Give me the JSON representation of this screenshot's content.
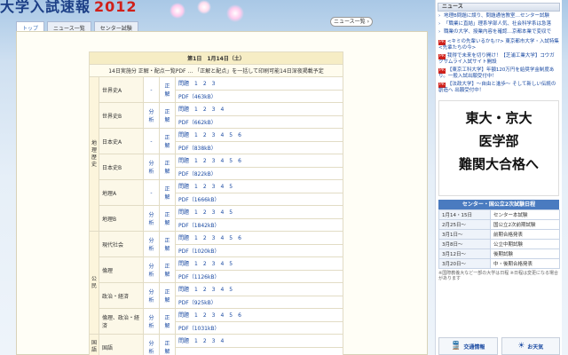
{
  "header": {
    "logo": "大学入試速報",
    "year": "2012",
    "news_list_button": "ニュース一覧 ›"
  },
  "tabs": [
    {
      "label": "トップ"
    },
    {
      "label": "ニュース一覧"
    },
    {
      "label": "センター試験"
    }
  ],
  "exam": {
    "day_header": "第1日　1月14日（土）",
    "note": "14日実施分 正解・配点一覧PDF … 「正解と配点」を一括して印刷可能14日深夜掲載予定",
    "categories": {
      "geo": "地理歴史",
      "civics": "公民",
      "lang": "国語"
    },
    "rows": [
      {
        "subject": "世界史A",
        "analysis": "-",
        "answer": "正解",
        "q": "問題　1　2　3",
        "pdf": "PDF（463kB）"
      },
      {
        "subject": "世界史B",
        "analysis": "分析",
        "answer": "正解",
        "q": "問題　1　2　3　4",
        "pdf": "PDF（662kB）"
      },
      {
        "subject": "日本史A",
        "analysis": "-",
        "answer": "正解",
        "q": "問題　1　2　3　4　5　6",
        "pdf": "PDF（838kB）"
      },
      {
        "subject": "日本史B",
        "analysis": "分析",
        "answer": "正解",
        "q": "問題　1　2　3　4　5　6",
        "pdf": "PDF（822kB）"
      },
      {
        "subject": "地理A",
        "analysis": "-",
        "answer": "正解",
        "q": "問題　1　2　3　4　5",
        "pdf": "PDF（1666kB）"
      },
      {
        "subject": "地理B",
        "analysis": "分析",
        "answer": "正解",
        "q": "問題　1　2　3　4　5",
        "pdf": "PDF（1842kB）"
      },
      {
        "subject": "現代社会",
        "analysis": "分析",
        "answer": "正解",
        "q": "問題　1　2　3　4　5　6",
        "pdf": "PDF（1020kB）"
      },
      {
        "subject": "倫理",
        "analysis": "分析",
        "answer": "正解",
        "q": "問題　1　2　3　4　5",
        "pdf": "PDF（1126kB）"
      },
      {
        "subject": "政治・経済",
        "analysis": "分析",
        "answer": "正解",
        "q": "問題　1　2　3　4　5",
        "pdf": "PDF（925kB）"
      },
      {
        "subject": "倫理、政治・経済",
        "analysis": "分析",
        "answer": "正解",
        "q": "問題　1　2　3　4　5　6",
        "pdf": "PDF（1031kB）"
      },
      {
        "subject": "国語",
        "analysis": "分析",
        "answer": "正解",
        "q": "問題　1　2　3　4",
        "pdf": ""
      }
    ]
  },
  "sidebar": {
    "news_header": "ニュース",
    "news": [
      "地理B問題に誤り、問題通信教室…センター試験",
      "「職業に直結」理系学部人気、社会科学系は急落",
      "職業の大学、授業内容を確認…京都本業で変収で"
    ],
    "ads": [
      {
        "tag": "PR",
        "text": "<キミの先輩いるかも!?> 東京都市大学・入試特集 <先輩たちの今>"
      },
      {
        "tag": "PR",
        "text": "我得で未来を切り開け！【芝浦工業大学】コウガクサムライ入試サイト開設"
      },
      {
        "tag": "PR",
        "text": "【東京工科大学】年額120万円を給奨学金制度あり。一般入試出願受付中！"
      },
      {
        "tag": "PR",
        "text": "【法政大学】〜自由と進歩〜 そして新しい伝統の創造へ 出願受付中！"
      }
    ],
    "banner": {
      "line1": "東大・京大",
      "line2": "医学部",
      "line3": "難関大合格へ"
    },
    "schedule_header": "センター・国公立2次試験日程",
    "schedule": [
      {
        "date": "1月14・15日",
        "event": "センター本試験"
      },
      {
        "date": "2月25日〜",
        "event": "国公立2次前期試験"
      },
      {
        "date": "3月1日〜",
        "event": "前期合格発表"
      },
      {
        "date": "3月8日〜",
        "event": "公立中期試験"
      },
      {
        "date": "3月12日〜",
        "event": "後期試験"
      },
      {
        "date": "3月20日〜",
        "event": "中・後期合格発表"
      }
    ],
    "footnote": "※国際教養大など一部の大学は日程 ※日程は変更になる場合があります",
    "buttons": {
      "traffic": "交通情報",
      "weather": "お天気"
    }
  }
}
